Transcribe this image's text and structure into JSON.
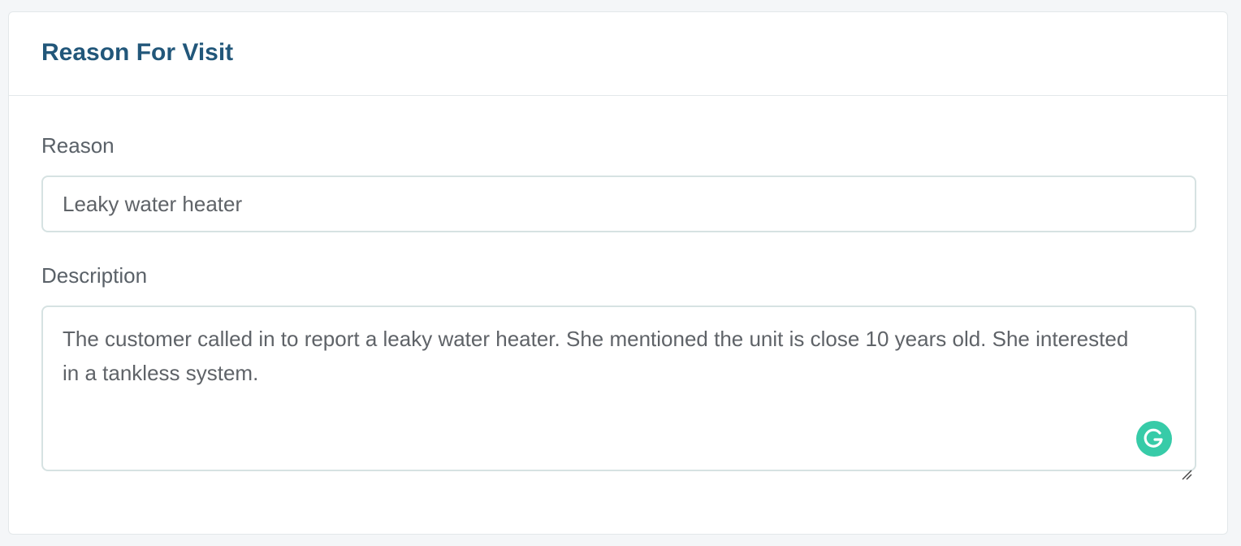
{
  "card": {
    "title": "Reason For Visit"
  },
  "reason": {
    "label": "Reason",
    "value": "Leaky water heater"
  },
  "description": {
    "label": "Description",
    "value": "The customer called in to report a leaky water heater. She mentioned the unit is close 10 years old. She interested in a tankless system."
  },
  "icons": {
    "grammarly": "grammarly-icon",
    "resize": "resize-handle-icon"
  },
  "colors": {
    "title": "#22577a",
    "grammarly": "#15c39a",
    "input_border": "#d6e2e2"
  }
}
